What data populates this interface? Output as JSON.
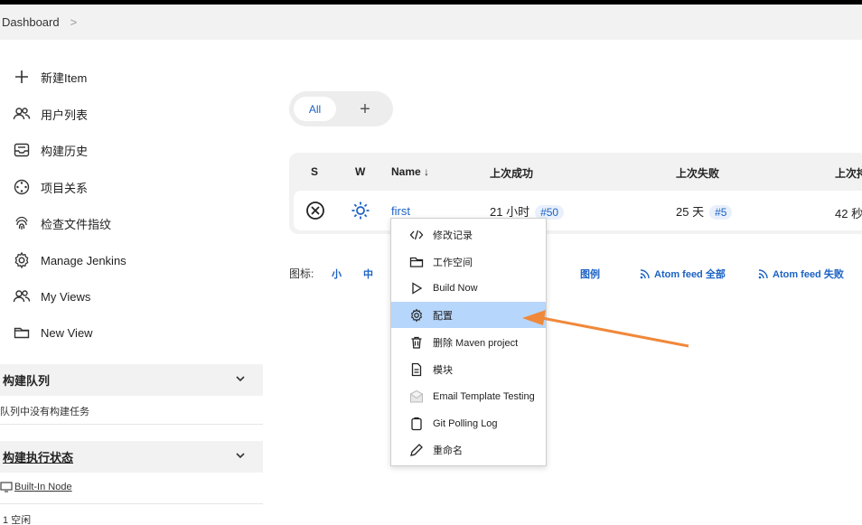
{
  "breadcrumb": {
    "item": "Dashboard"
  },
  "sidebar": {
    "items": [
      {
        "label": "新建Item"
      },
      {
        "label": "用户列表"
      },
      {
        "label": "构建历史"
      },
      {
        "label": "项目关系"
      },
      {
        "label": "检查文件指纹"
      },
      {
        "label": "Manage Jenkins"
      },
      {
        "label": "My Views"
      },
      {
        "label": "New View"
      }
    ]
  },
  "build_queue": {
    "title": "构建队列",
    "empty_text": "队列中没有构建任务"
  },
  "executor_status": {
    "title": "构建执行状态",
    "node": "Built-In Node",
    "executor": "1  空闲"
  },
  "views": {
    "all_tab": "All",
    "add_tab": "+"
  },
  "table": {
    "headers": {
      "s": "S",
      "w": "W",
      "name": "Name ↓",
      "last_success": "上次成功",
      "last_failure": "上次失败",
      "last_duration": "上次持"
    },
    "rows": [
      {
        "name": "first",
        "last_success": "21 小时",
        "success_build": "#50",
        "last_failure": "25 天",
        "failure_build": "#5",
        "last_duration": "42 秒"
      }
    ]
  },
  "legend": {
    "icon_label": "图标:",
    "small": "小",
    "medium": "中",
    "legend": "图例",
    "feed_all": "Atom feed 全部",
    "feed_failed": "Atom feed 失败"
  },
  "context_menu": {
    "items": [
      {
        "label": "修改记录"
      },
      {
        "label": "工作空间"
      },
      {
        "label": "Build Now"
      },
      {
        "label": "配置"
      },
      {
        "label": "删除 Maven project"
      },
      {
        "label": "模块"
      },
      {
        "label": "Email Template Testing"
      },
      {
        "label": "Git Polling Log"
      },
      {
        "label": "重命名"
      }
    ],
    "active_index": 3
  },
  "colors": {
    "accent": "#1b62c4",
    "highlight": "#b7d6fb",
    "arrow": "#f0883a",
    "rss": "#1b62c4"
  }
}
